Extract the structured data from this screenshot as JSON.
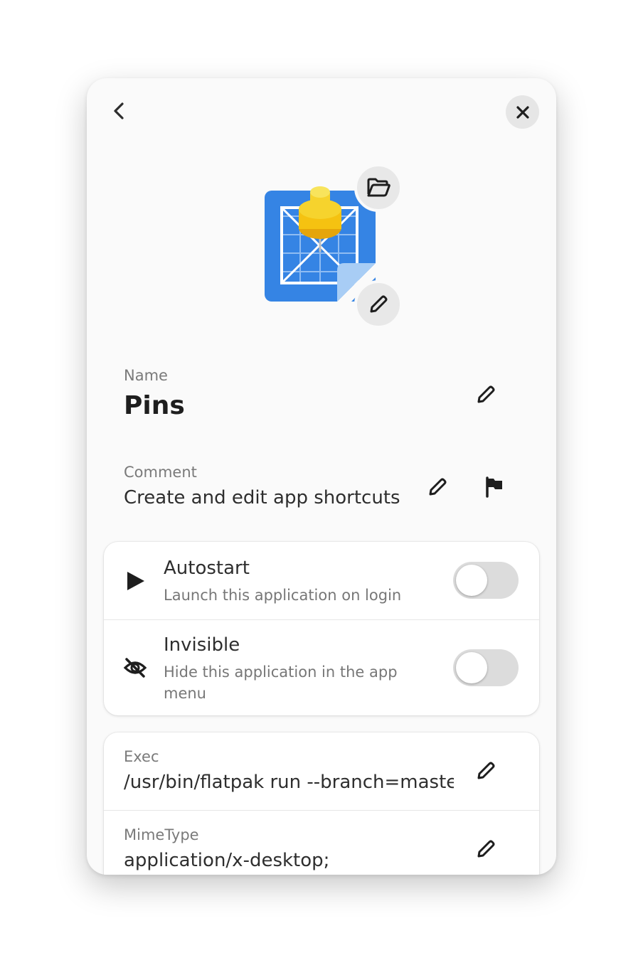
{
  "header": {
    "back_icon": "go-back-icon",
    "close_icon": "close-icon"
  },
  "icon_editor": {
    "app_icon": "pins-app-icon",
    "pick_icon": "folder-open-icon",
    "edit_icon": "pencil-icon"
  },
  "name": {
    "label": "Name",
    "value": "Pins"
  },
  "comment": {
    "label": "Comment",
    "value": "Create and edit app shortcuts"
  },
  "toggles": [
    {
      "icon": "play-icon",
      "title": "Autostart",
      "subtitle": "Launch this application on login",
      "enabled": false
    },
    {
      "icon": "eye-slash-icon",
      "title": "Invisible",
      "subtitle": "Hide this application in the app menu",
      "enabled": false
    }
  ],
  "keys": [
    {
      "label": "Exec",
      "value": "/usr/bin/flatpak run --branch=maste"
    },
    {
      "label": "MimeType",
      "value": "application/x-desktop;"
    }
  ],
  "colors": {
    "window_bg": "#fafafa",
    "card_bg": "#ffffff",
    "accent_blue": "#3584e4",
    "pin_yellow": "#f6d32d"
  }
}
